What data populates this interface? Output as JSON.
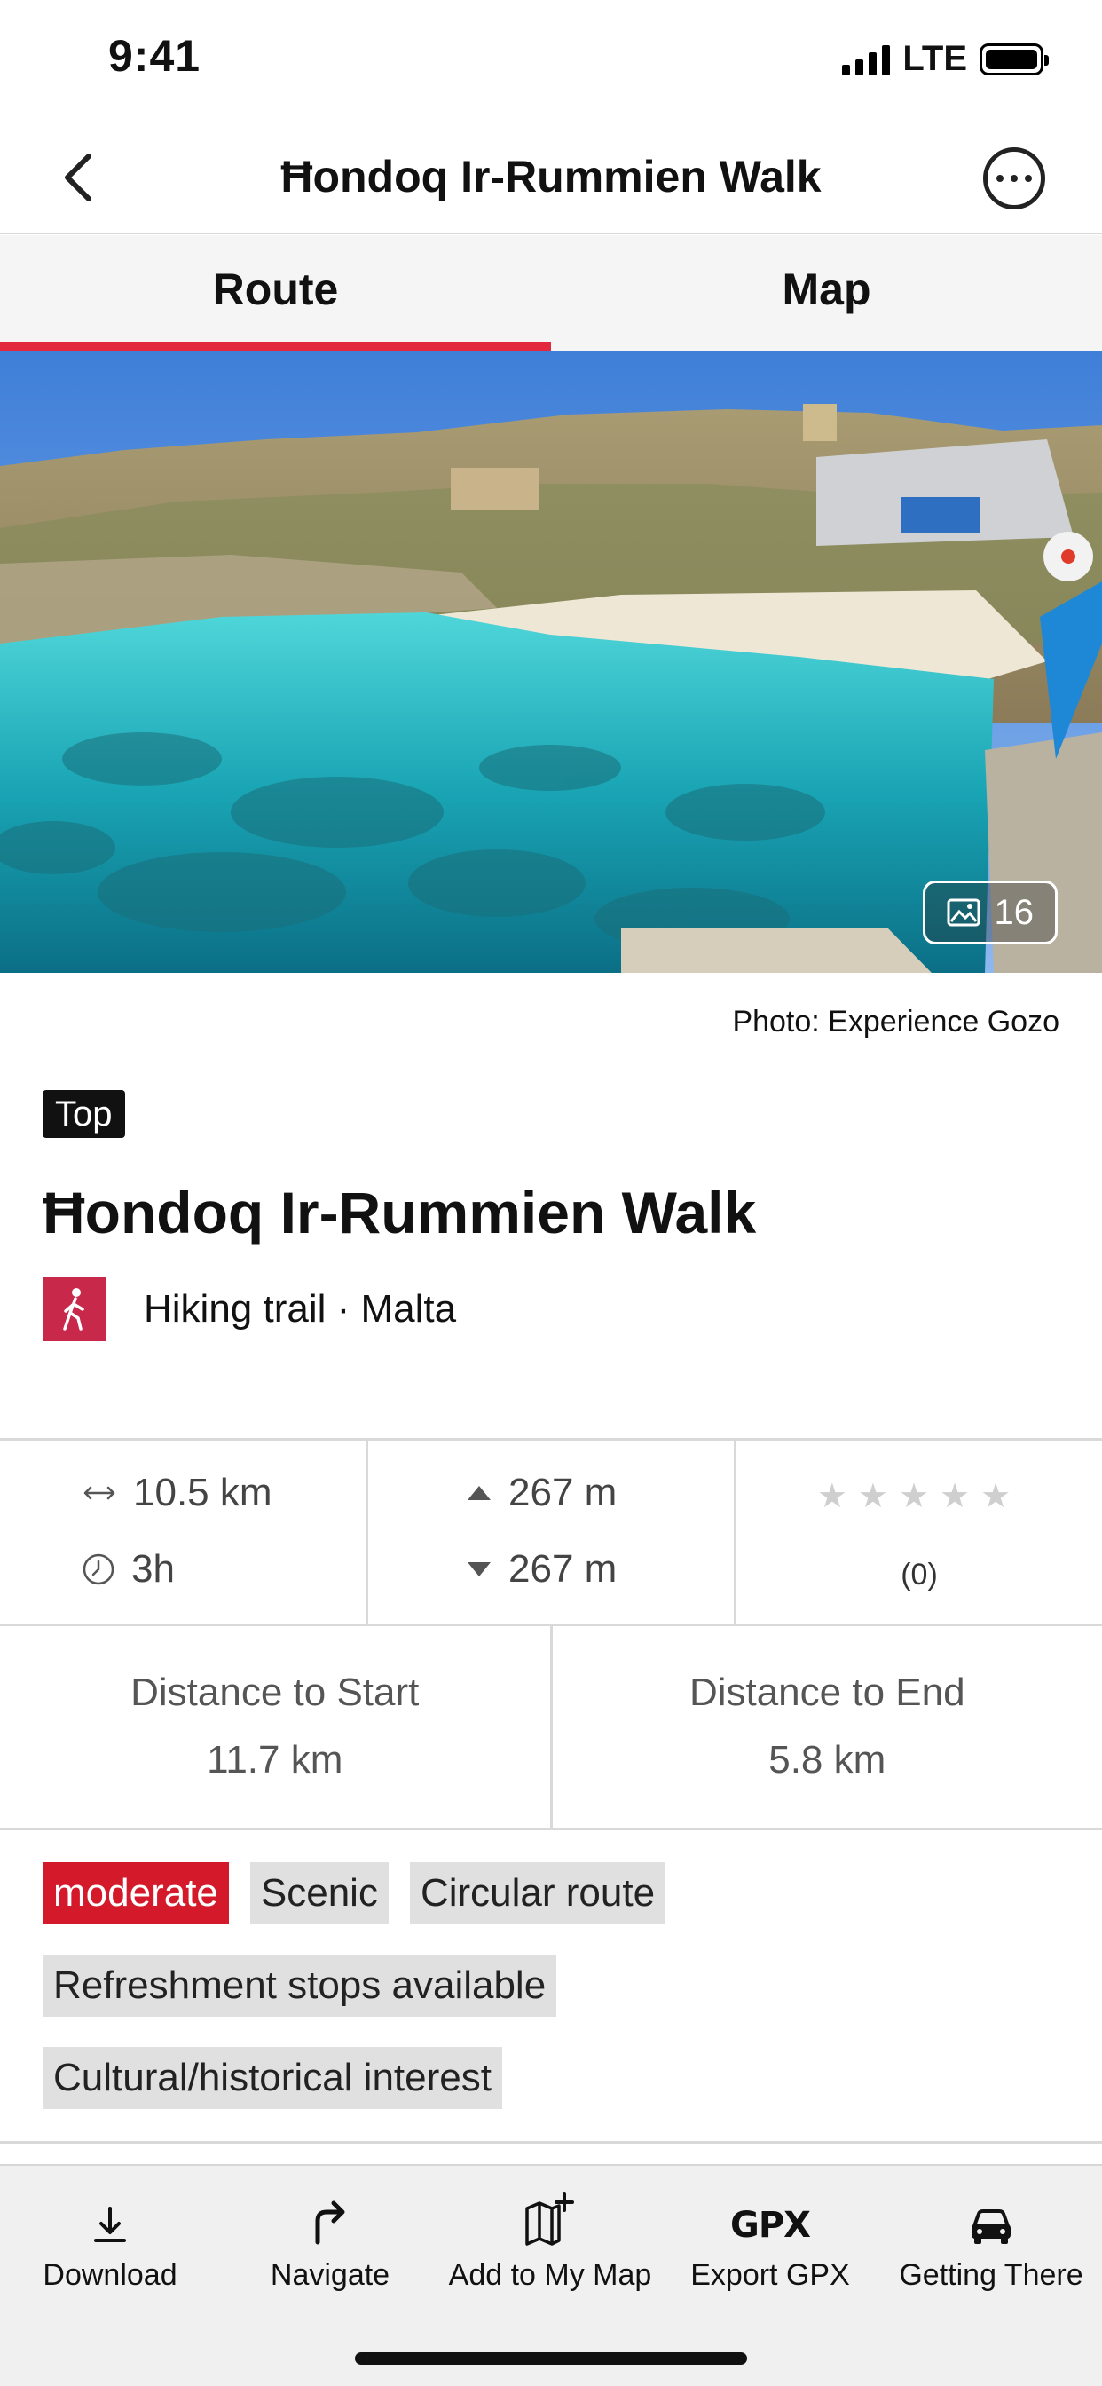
{
  "status_bar": {
    "time": "9:41",
    "network": "LTE"
  },
  "nav": {
    "title": "Ħondoq Ir-Rummien Walk"
  },
  "tabs": [
    {
      "label": "Route",
      "active": true
    },
    {
      "label": "Map",
      "active": false
    }
  ],
  "hero": {
    "photo_count": "16",
    "credit": "Photo: Experience Gozo"
  },
  "route": {
    "badge": "Top",
    "title": "Ħondoq Ir-Rummien Walk",
    "meta": "Hiking trail · Malta",
    "type_color": "#c8284a"
  },
  "stats": {
    "distance": "10.5 km",
    "duration": "3h",
    "ascent": "267 m",
    "descent": "267 m",
    "stars": "★★★★★",
    "rating_value": 0,
    "rating_count": "(0)"
  },
  "distances": {
    "start_label": "Distance to Start",
    "start_value": "11.7 km",
    "end_label": "Distance to End",
    "end_value": "5.8 km"
  },
  "tags": {
    "difficulty": "moderate",
    "scenic": "Scenic",
    "circular": "Circular route",
    "refreshment": "Refreshment stops available",
    "cultural": "Cultural/historical interest"
  },
  "toolbar": {
    "download": "Download",
    "navigate": "Navigate",
    "add_to_map": "Add to My Map",
    "export_gpx": "Export GPX",
    "gpx_icon_text": "GPX",
    "getting_there": "Getting There"
  },
  "colors": {
    "accent": "#e3283e",
    "difficulty": "#d41a2a"
  }
}
